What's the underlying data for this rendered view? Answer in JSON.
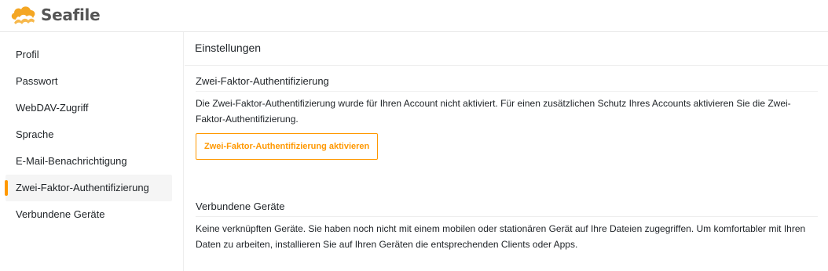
{
  "app": {
    "name": "Seafile",
    "logo_colors": {
      "cloud": "#f4a623",
      "wave": "#f7b84b"
    }
  },
  "sidebar": {
    "items": [
      {
        "label": "Profil",
        "active": false
      },
      {
        "label": "Passwort",
        "active": false
      },
      {
        "label": "WebDAV-Zugriff",
        "active": false
      },
      {
        "label": "Sprache",
        "active": false
      },
      {
        "label": "E-Mail-Benachrichtigung",
        "active": false
      },
      {
        "label": "Zwei-Faktor-Authentifizierung",
        "active": true
      },
      {
        "label": "Verbundene Geräte",
        "active": false
      }
    ],
    "active_indicator_color": "#ff9800"
  },
  "main": {
    "title": "Einstellungen",
    "two_factor": {
      "title": "Zwei-Faktor-Authentifizierung",
      "description": "Die Zwei-Faktor-Authentifizierung wurde für Ihren Account nicht aktiviert. Für einen zusätzlichen Schutz Ihres Accounts aktivieren Sie die Zwei-Faktor-Authentifizierung.",
      "button_label": "Zwei-Faktor-Authentifizierung aktivieren"
    },
    "devices": {
      "title": "Verbundene Geräte",
      "description": "Keine verknüpften Geräte. Sie haben noch nicht mit einem mobilen oder stationären Gerät auf Ihre Dateien zugegriffen. Um komfortabler mit Ihren Daten zu arbeiten, installieren Sie auf Ihren Geräten die entsprechenden Clients oder Apps."
    }
  }
}
